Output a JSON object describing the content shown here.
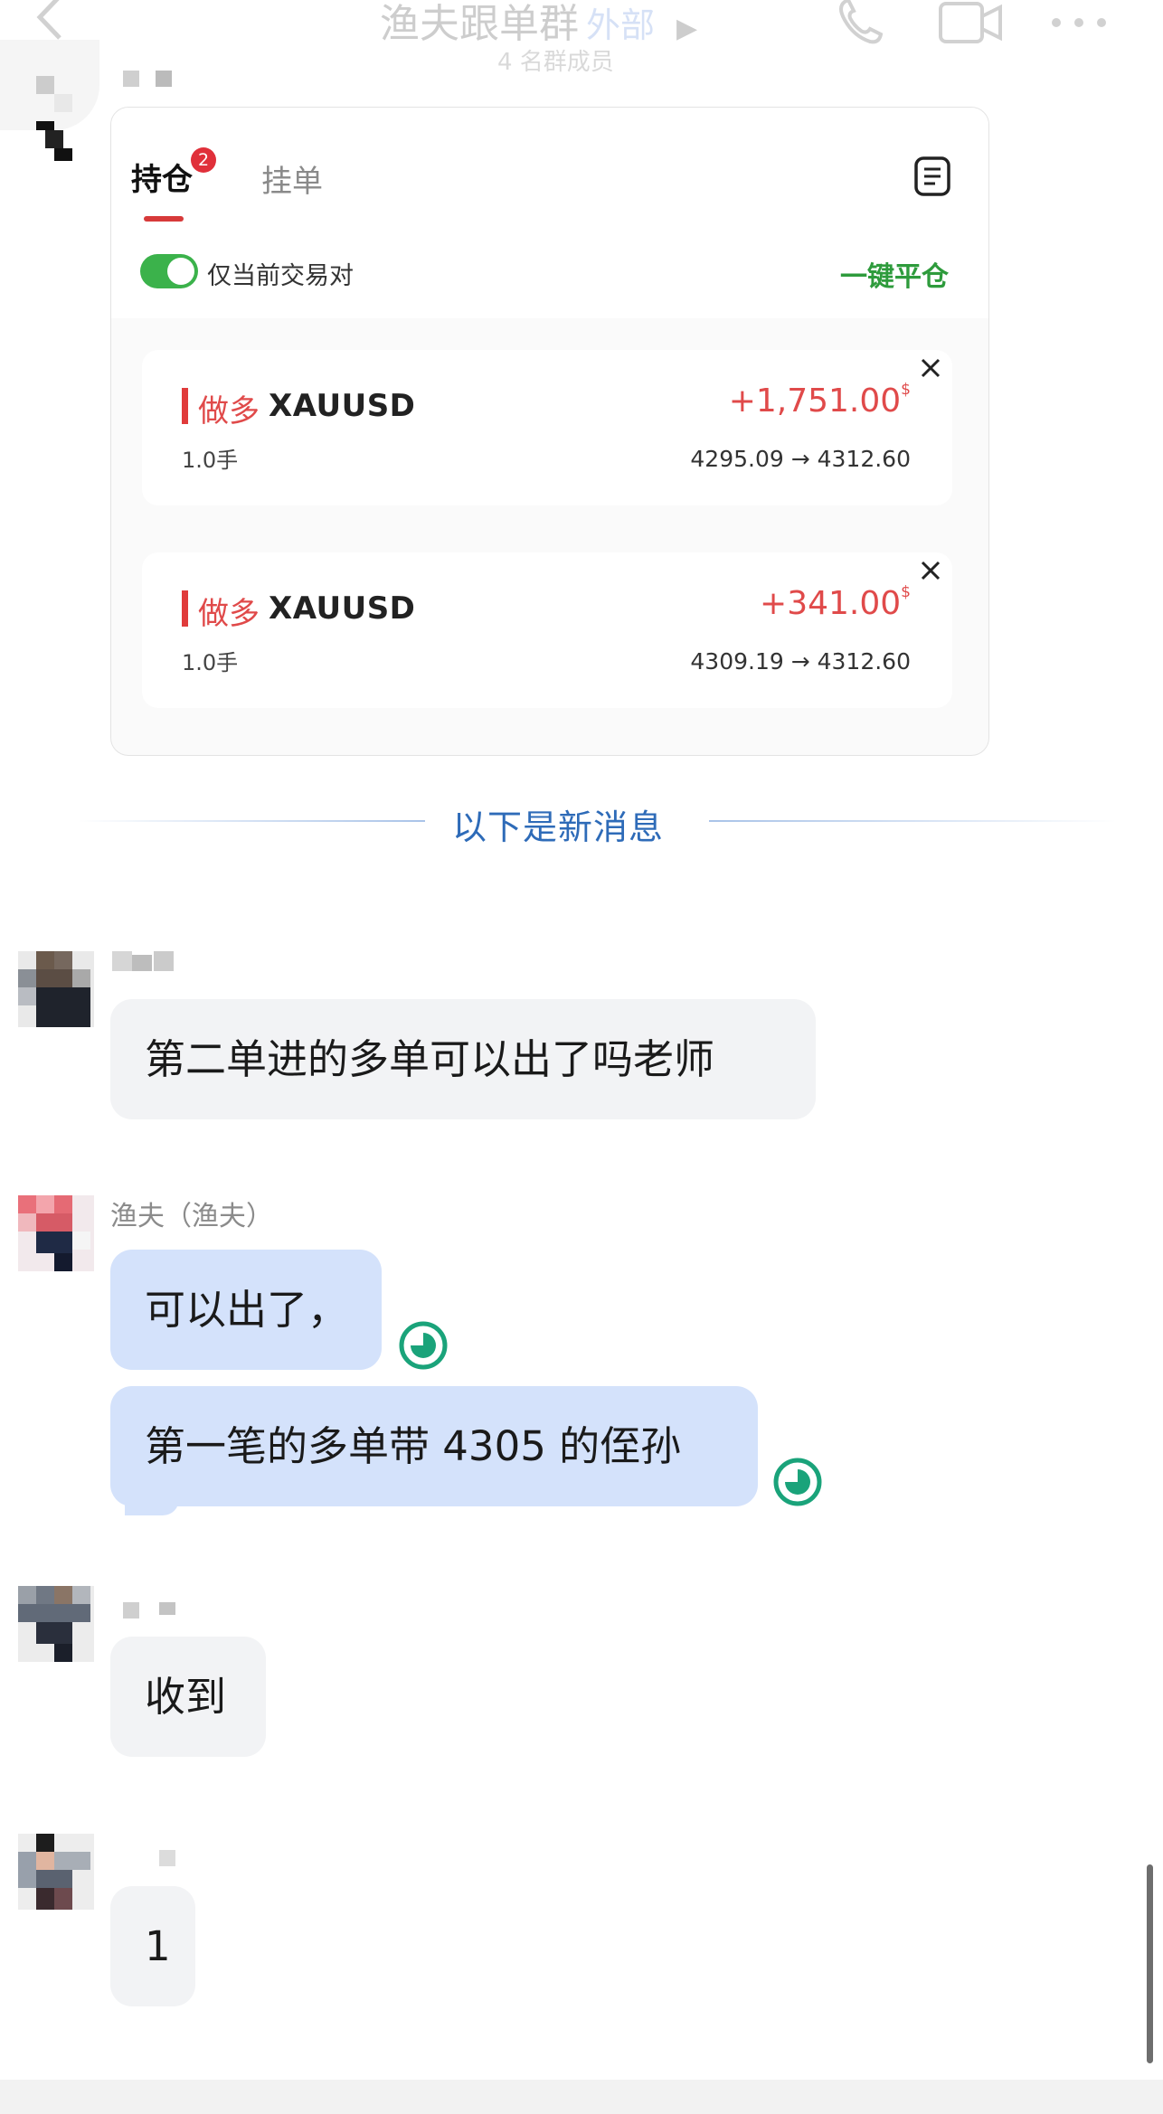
{
  "header": {
    "title": "渔夫跟单群",
    "badge": "外部",
    "subtitle": "4 名群成员"
  },
  "card": {
    "tabs": [
      {
        "label": "持仓",
        "badge": "2",
        "active": true
      },
      {
        "label": "挂单",
        "active": false
      }
    ],
    "toggle_label": "仅当前交易对",
    "toggle_on": true,
    "close_all_label": "一键平仓",
    "positions": [
      {
        "direction": "做多",
        "symbol": "XAUUSD",
        "lots": "1.0手",
        "pnl": "+1,751.00",
        "currency": "$",
        "route": "4295.09 → 4312.60"
      },
      {
        "direction": "做多",
        "symbol": "XAUUSD",
        "lots": "1.0手",
        "pnl": "+341.00",
        "currency": "$",
        "route": "4309.19 → 4312.60"
      }
    ]
  },
  "divider": {
    "label": "以下是新消息"
  },
  "messages": [
    {
      "sender": "",
      "text": "第二单进的多单可以出了吗老师"
    },
    {
      "sender": "渔夫（渔夫）",
      "texts": [
        "可以出了，",
        "第一笔的多单带 4305 的侄孙"
      ]
    },
    {
      "sender": "",
      "text": "收到"
    },
    {
      "sender": "",
      "text": "1"
    }
  ],
  "colors": {
    "accent_red": "#e04a4a",
    "accent_green": "#2e9b3c",
    "divider_blue": "#2e6bb8",
    "bubble_mine": "#d4e2fb",
    "bubble_other": "#f2f3f5",
    "status_teal": "#1aa37a"
  },
  "icons": [
    "back-icon",
    "arrow-right-icon",
    "phone-icon",
    "video-icon",
    "more-icon",
    "document-icon",
    "close-icon",
    "pending-clock-icon"
  ]
}
